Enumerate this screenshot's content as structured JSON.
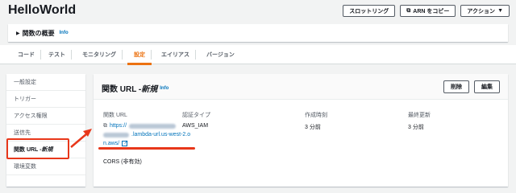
{
  "header": {
    "title": "HelloWorld",
    "actions": {
      "throttle_label": "スロットリング",
      "copy_arn_label": "ARN をコピー",
      "actions_label": "アクション",
      "actions_caret": "▼"
    }
  },
  "overview": {
    "caret": "▶",
    "title": "関数の概要",
    "info": "Info"
  },
  "tabs": [
    {
      "label": "コード"
    },
    {
      "label": "テスト"
    },
    {
      "label": "モニタリング"
    },
    {
      "label": "設定",
      "active": true
    },
    {
      "label": "エイリアス"
    },
    {
      "label": "バージョン"
    }
  ],
  "sidebar": {
    "items": [
      {
        "label": "一般設定"
      },
      {
        "label": "トリガー"
      },
      {
        "label": "アクセス権限"
      },
      {
        "label": "送信先"
      },
      {
        "label": "関数 URL - ",
        "label_em": "新規",
        "active": true
      },
      {
        "label": "環境変数"
      }
    ]
  },
  "panel": {
    "title": "関数 URL - ",
    "title_em": "新規",
    "info": "Info",
    "delete_label": "削除",
    "edit_label": "編集",
    "url_label": "関数 URL",
    "url_prefix": "https://",
    "url_middle": ".lambda-url.us-west-2.o",
    "url_end": "n.aws/",
    "auth_label": "認証タイプ",
    "auth_value": "AWS_IAM",
    "created_label": "作成時刻",
    "created_value": "3 分前",
    "updated_label": "最終更新",
    "updated_value": "3 分前",
    "cors": "CORS (非有効)"
  },
  "colors": {
    "accent": "#ec7211",
    "link": "#0073bb",
    "annotation": "#e8371a"
  }
}
